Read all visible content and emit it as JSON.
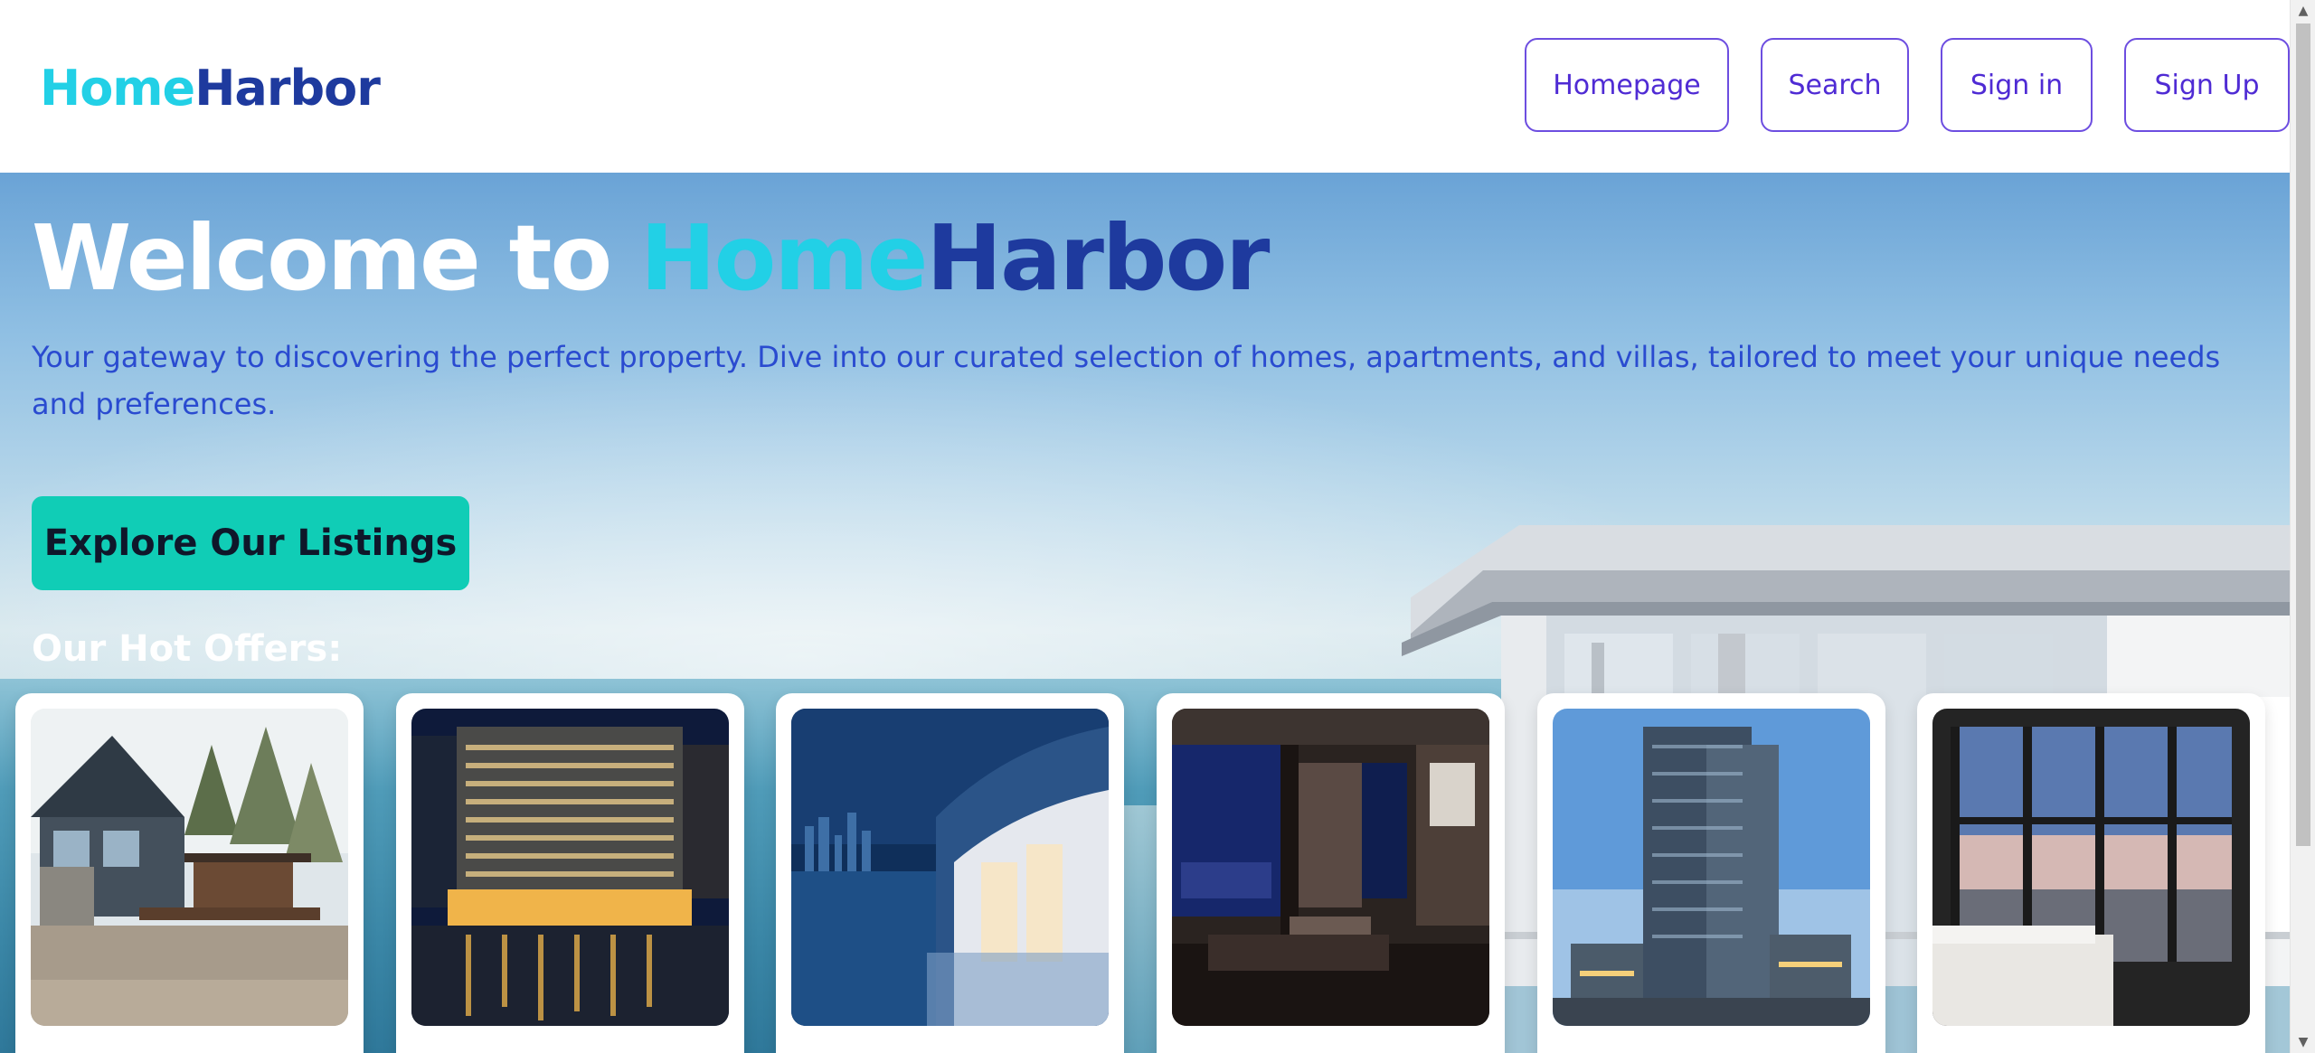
{
  "header": {
    "logo_part1": "Home",
    "logo_part2": "Harbor",
    "nav": [
      {
        "label": "Homepage"
      },
      {
        "label": "Search"
      },
      {
        "label": "Sign in"
      },
      {
        "label": "Sign Up"
      }
    ]
  },
  "hero": {
    "title_prefix": "Welcome to ",
    "title_part1": "Home",
    "title_part2": "Harbor",
    "subtitle": "Your gateway to discovering the perfect property. Dive into our curated selection of homes, apartments, and villas, tailored to meet your unique needs and preferences.",
    "cta_label": "Explore Our Listings",
    "offers_heading": "Our Hot Offers:"
  },
  "offers": [
    {
      "image": "cabin-house-photo"
    },
    {
      "image": "riverfront-tower-night-photo"
    },
    {
      "image": "waterfront-balcony-skyline-photo"
    },
    {
      "image": "luxury-living-room-night-photo"
    },
    {
      "image": "highrise-apartment-tower-photo"
    },
    {
      "image": "bedroom-city-view-photo"
    }
  ],
  "colors": {
    "brand_cyan": "#22d0e6",
    "brand_navy": "#1e3a9e",
    "nav_accent": "#4f2bd4",
    "cta": "#10cdb6",
    "subtitle": "#2a4bd0"
  }
}
